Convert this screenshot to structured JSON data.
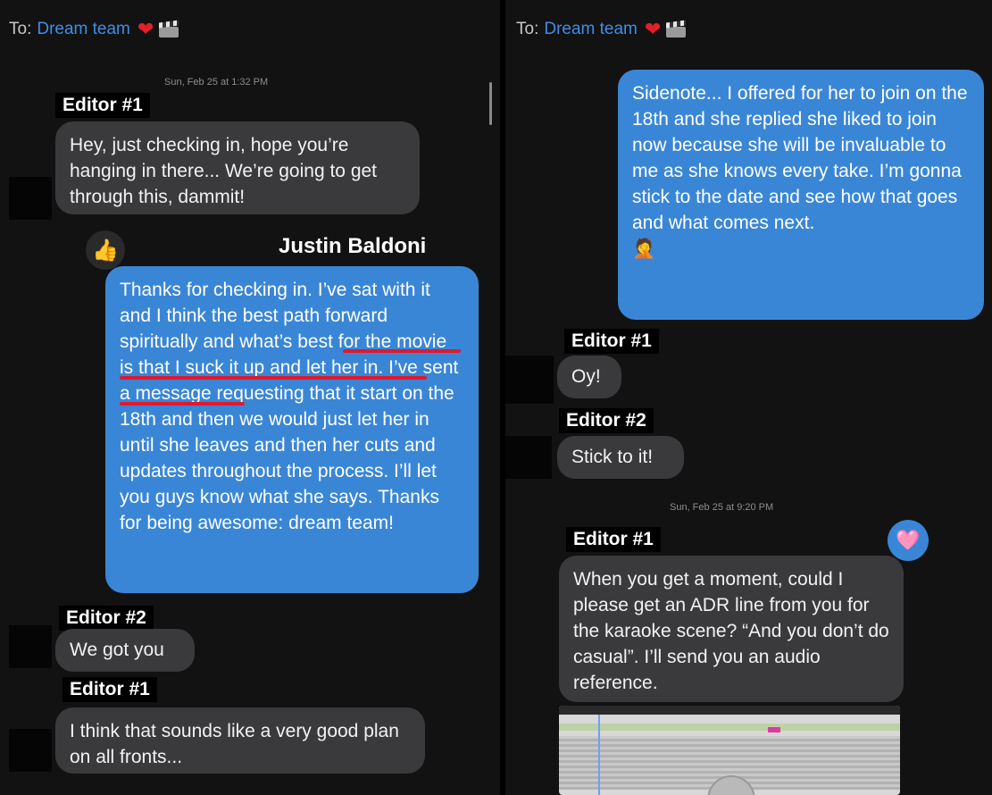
{
  "left": {
    "header": {
      "to_label": "To:",
      "recipient": "Dream team"
    },
    "timestamp": "Sun, Feb 25 at 1:32 PM",
    "messages": [
      {
        "sender": "Editor #1",
        "text": "Hey, just checking in, hope you’re hanging in there... We’re going to get through this, dammit!"
      },
      {
        "sender": "Justin Baldoni",
        "reaction": "👍",
        "text": "Thanks for checking in. I’ve sat with it and I think the best path forward spiritually and what’s best for the movie is that I suck it up and let her in. I’ve sent a message requesting that it start on the 18th and then we would just let her in until she leaves and then her cuts and updates throughout the process. I’ll let you guys know what she says. Thanks for being awesome: dream team!"
      },
      {
        "sender": "Editor #2",
        "text": "We got you"
      },
      {
        "sender": "Editor #1",
        "text": "I think that sounds like a very good plan on all fronts..."
      }
    ]
  },
  "right": {
    "header": {
      "to_label": "To:",
      "recipient": "Dream team"
    },
    "sidenote": "Sidenote... I offered for her to join on the 18th and she replied she liked to join now because she will be invaluable to me as she knows every take. I’m gonna stick to the date and see how that goes and what comes next.",
    "sidenote_emoji": "🤦",
    "messages": [
      {
        "sender": "Editor #1",
        "text": "Oy!"
      },
      {
        "sender": "Editor #2",
        "text": "Stick to it!"
      }
    ],
    "timestamp": "Sun, Feb 25 at 9:20 PM",
    "last": {
      "sender": "Editor #1",
      "reaction": "🩷",
      "text": "When you get a moment, could I please get an ADR line from you for the karaoke scene? “And you don’t do casual”. I’ll send you an audio reference."
    }
  },
  "colors": {
    "blue_bubble": "#3a86d6",
    "gray_bubble": "#3a3a3c",
    "underline": "#e0192d",
    "recipient": "#3f8ee8"
  },
  "icons": [
    "heart-icon",
    "clapperboard-icon",
    "thumbs-up-reaction-icon",
    "heart-reaction-icon",
    "play-icon"
  ]
}
